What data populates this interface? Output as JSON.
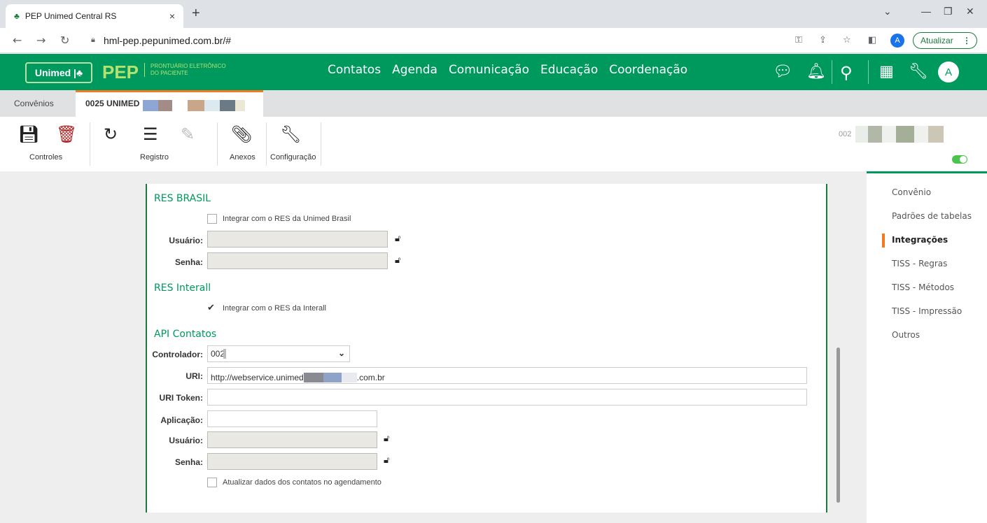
{
  "browser": {
    "tab_title": "PEP Unimed Central RS",
    "tab_close": "×",
    "new_tab": "+",
    "url": "hml-pep.pepunimed.com.br/#",
    "profile_initial": "A",
    "update_label": "Atualizar"
  },
  "app": {
    "logo_text": "Unimed",
    "brand": "PEP",
    "brand_subtitle_line1": "PRONTUÁRIO ELETRÔNICO",
    "brand_subtitle_line2": "DO PACIENTE",
    "nav": [
      "Contatos",
      "Agenda",
      "Comunicação",
      "Educação",
      "Coordenação"
    ],
    "user_initial": "A"
  },
  "subtabs": {
    "first": "Convênios",
    "second": "0025 UNIMED"
  },
  "actions": {
    "controles": "Controles",
    "registro": "Registro",
    "anexos": "Anexos",
    "configuracao": "Configuração",
    "record_code": "002"
  },
  "sidebar": {
    "items": [
      "Convênio",
      "Padrões de tabelas",
      "Integrações",
      "TISS - Regras",
      "TISS - Métodos",
      "TISS - Impressão",
      "Outros"
    ],
    "active": "Integrações"
  },
  "res_brasil": {
    "title": "RES BRASIL",
    "checkbox_label": "Integrar com o RES da Unimed Brasil",
    "checked": false,
    "usuario_label": "Usuário:",
    "senha_label": "Senha:"
  },
  "res_interall": {
    "title": "RES Interall",
    "checkbox_label": "Integrar com o RES da Interall",
    "checked": true
  },
  "api_contatos": {
    "title": "API Contatos",
    "controlador_label": "Controlador:",
    "controlador_value": "002",
    "uri_label": "URI:",
    "uri_value_prefix": "http://webservice.unimed",
    "uri_value_suffix": ".com.br",
    "uri_token_label": "URI Token:",
    "aplicacao_label": "Aplicação:",
    "usuario_label": "Usuário:",
    "senha_label": "Senha:",
    "checkbox_label": "Atualizar dados dos contatos no agendamento",
    "checked": false
  }
}
